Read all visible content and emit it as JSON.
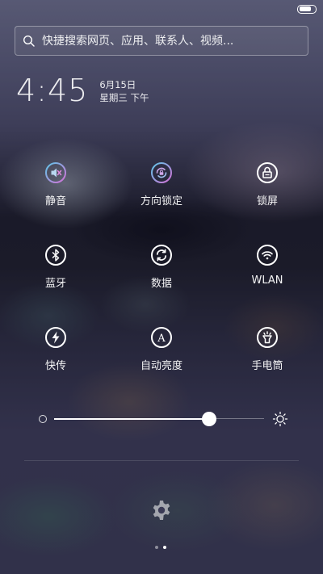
{
  "search": {
    "placeholder": "快捷搜索网页、应用、联系人、视频..."
  },
  "clock": {
    "time": "4:45",
    "date": "6月15日",
    "weekday": "星期三 下午"
  },
  "toggles": [
    {
      "label": "静音",
      "icon": "mute-icon"
    },
    {
      "label": "方向锁定",
      "icon": "rotation-lock-icon"
    },
    {
      "label": "锁屏",
      "icon": "lock-screen-icon"
    },
    {
      "label": "蓝牙",
      "icon": "bluetooth-icon"
    },
    {
      "label": "数据",
      "icon": "mobile-data-icon"
    },
    {
      "label": "WLAN",
      "icon": "wifi-icon"
    },
    {
      "label": "快传",
      "icon": "quick-transfer-icon"
    },
    {
      "label": "自动亮度",
      "icon": "auto-brightness-icon"
    },
    {
      "label": "手电筒",
      "icon": "flashlight-icon"
    }
  ],
  "brightness": {
    "level": 0.74
  },
  "pager": {
    "pages": 2,
    "current": 1
  },
  "colors": {
    "active_gradient_start": "#5fc7e8",
    "active_gradient_end": "#d46fd6"
  }
}
